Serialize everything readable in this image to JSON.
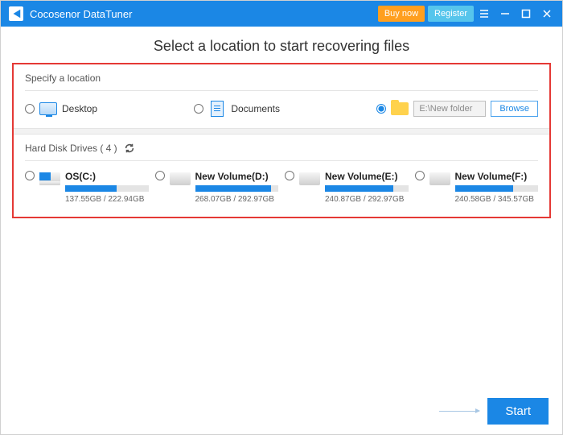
{
  "app": {
    "title": "Cocosenor DataTuner"
  },
  "titlebar": {
    "buy": "Buy now",
    "register": "Register"
  },
  "heading": "Select a location to start recovering files",
  "specify": {
    "title": "Specify a location",
    "desktop": "Desktop",
    "documents": "Documents",
    "custom_path": "E:\\New folder",
    "browse": "Browse"
  },
  "drives": {
    "title": "Hard Disk Drives ( 4 )",
    "items": [
      {
        "name": "OS(C:)",
        "size": "137.55GB / 222.94GB",
        "pct": 62
      },
      {
        "name": "New Volume(D:)",
        "size": "268.07GB / 292.97GB",
        "pct": 91
      },
      {
        "name": "New Volume(E:)",
        "size": "240.87GB / 292.97GB",
        "pct": 82
      },
      {
        "name": "New Volume(F:)",
        "size": "240.58GB / 345.57GB",
        "pct": 70
      }
    ]
  },
  "footer": {
    "start": "Start"
  }
}
